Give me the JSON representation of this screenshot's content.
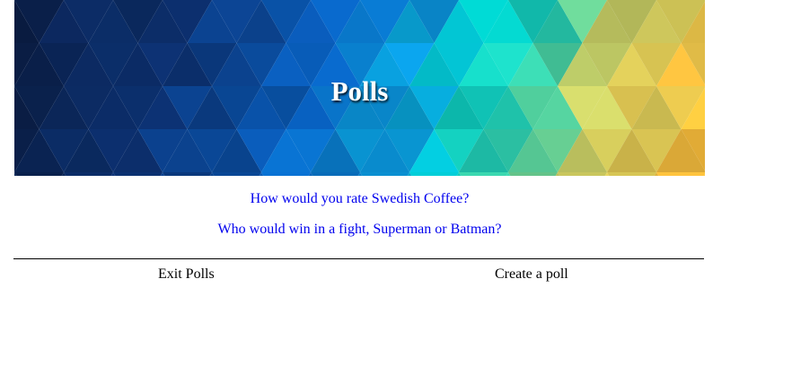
{
  "header": {
    "title": "Polls"
  },
  "polls": [
    {
      "question": "How would you rate Swedish Coffee?"
    },
    {
      "question": "Who would win in a fight, Superman or Batman?"
    }
  ],
  "footer": {
    "exit_label": "Exit Polls",
    "create_label": "Create a poll"
  },
  "colors": {
    "link": "#0000ee",
    "text": "#000000",
    "background": "#ffffff"
  }
}
